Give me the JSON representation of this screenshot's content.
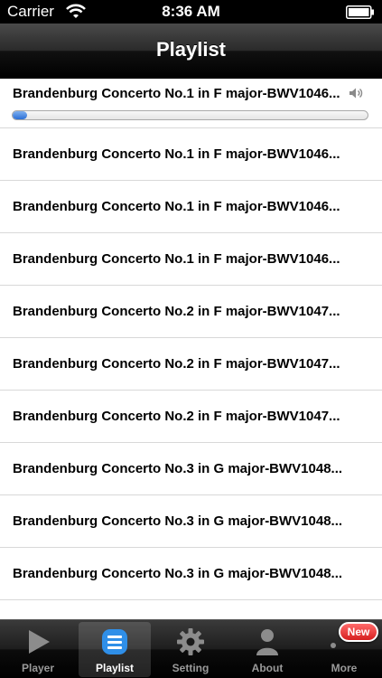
{
  "status_bar": {
    "carrier": "Carrier",
    "time": "8:36 AM"
  },
  "nav": {
    "title": "Playlist"
  },
  "now_playing": {
    "title": "Brandenburg Concerto No.1 in F major-BWV1046...",
    "progress": 0.03
  },
  "playlist": [
    {
      "title": "Brandenburg Concerto No.1 in F major-BWV1046..."
    },
    {
      "title": "Brandenburg Concerto No.1 in F major-BWV1046..."
    },
    {
      "title": "Brandenburg Concerto No.1 in F major-BWV1046..."
    },
    {
      "title": "Brandenburg Concerto No.2 in F major-BWV1047..."
    },
    {
      "title": "Brandenburg Concerto No.2 in F major-BWV1047..."
    },
    {
      "title": "Brandenburg Concerto No.2 in F major-BWV1047..."
    },
    {
      "title": "Brandenburg Concerto No.3 in G major-BWV1048..."
    },
    {
      "title": "Brandenburg Concerto No.3 in G major-BWV1048..."
    },
    {
      "title": "Brandenburg Concerto No.3 in G major-BWV1048..."
    }
  ],
  "tabs": [
    {
      "label": "Player",
      "icon": "play-icon"
    },
    {
      "label": "Playlist",
      "icon": "playlist-icon",
      "selected": true
    },
    {
      "label": "Setting",
      "icon": "gear-icon"
    },
    {
      "label": "About",
      "icon": "person-icon"
    },
    {
      "label": "More",
      "icon": "more-icon"
    }
  ],
  "badge": {
    "label": "New"
  },
  "colors": {
    "accent": "#2b6fd6",
    "badge": "#d61d1d",
    "tab_selected": "#ffffff",
    "tab_inactive": "#9a9a9a"
  }
}
